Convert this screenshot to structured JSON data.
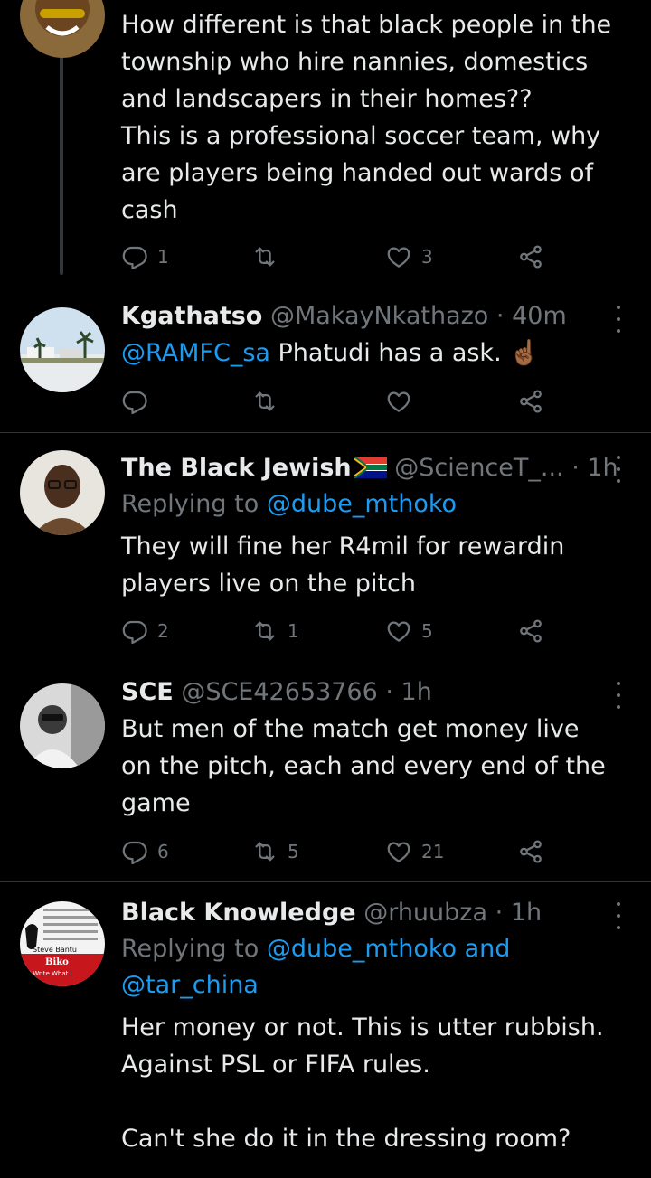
{
  "tweets": [
    {
      "text": "How different is that black people in the township who hire nannies, domestics and landscapers in their homes??\nThis is a professional soccer team, why are players being handed out wards of cash",
      "replies": "1",
      "retweets": "",
      "likes": "3"
    },
    {
      "name": "Kgathatso",
      "handle": "@MakayNkathazo",
      "time": "· 40m",
      "mention": "@RAMFC_sa",
      "text": " Phatudi has a ask. ☝🏾",
      "replies": "",
      "retweets": "",
      "likes": ""
    },
    {
      "name": "The Black Jewish",
      "handle": "@ScienceT_...",
      "time": "· 1h",
      "replying_prefix": "Replying to ",
      "replying_to": "@dube_mthoko",
      "text": "They will fine her R4mil for rewardin players live on the pitch",
      "replies": "2",
      "retweets": "1",
      "likes": "5"
    },
    {
      "name": "SCE",
      "handle": "@SCE42653766",
      "time": "· 1h",
      "text": "But men of the match get money live on the pitch, each and every end of the game",
      "replies": "6",
      "retweets": "5",
      "likes": "21"
    },
    {
      "name": "Black Knowledge",
      "handle": "@rhuubza",
      "time": "· 1h",
      "replying_prefix": "Replying to ",
      "replying_to": "@dube_mthoko and @tar_china",
      "text": "Her money or not. This is utter rubbish. Against PSL or FIFA rules.\n\nCan't she do it in the dressing room?",
      "avatar_text": [
        "Steve Bantu",
        "Biko",
        "I Write What I"
      ]
    }
  ],
  "colors": {
    "background": "#000000",
    "text": "#e7e9ea",
    "muted": "#71767b",
    "link": "#1d9bf0",
    "separator": "#2f3336"
  },
  "icons": {
    "reply": "reply-icon",
    "retweet": "retweet-icon",
    "like": "heart-icon",
    "share": "share-icon",
    "more": "more-icon"
  }
}
